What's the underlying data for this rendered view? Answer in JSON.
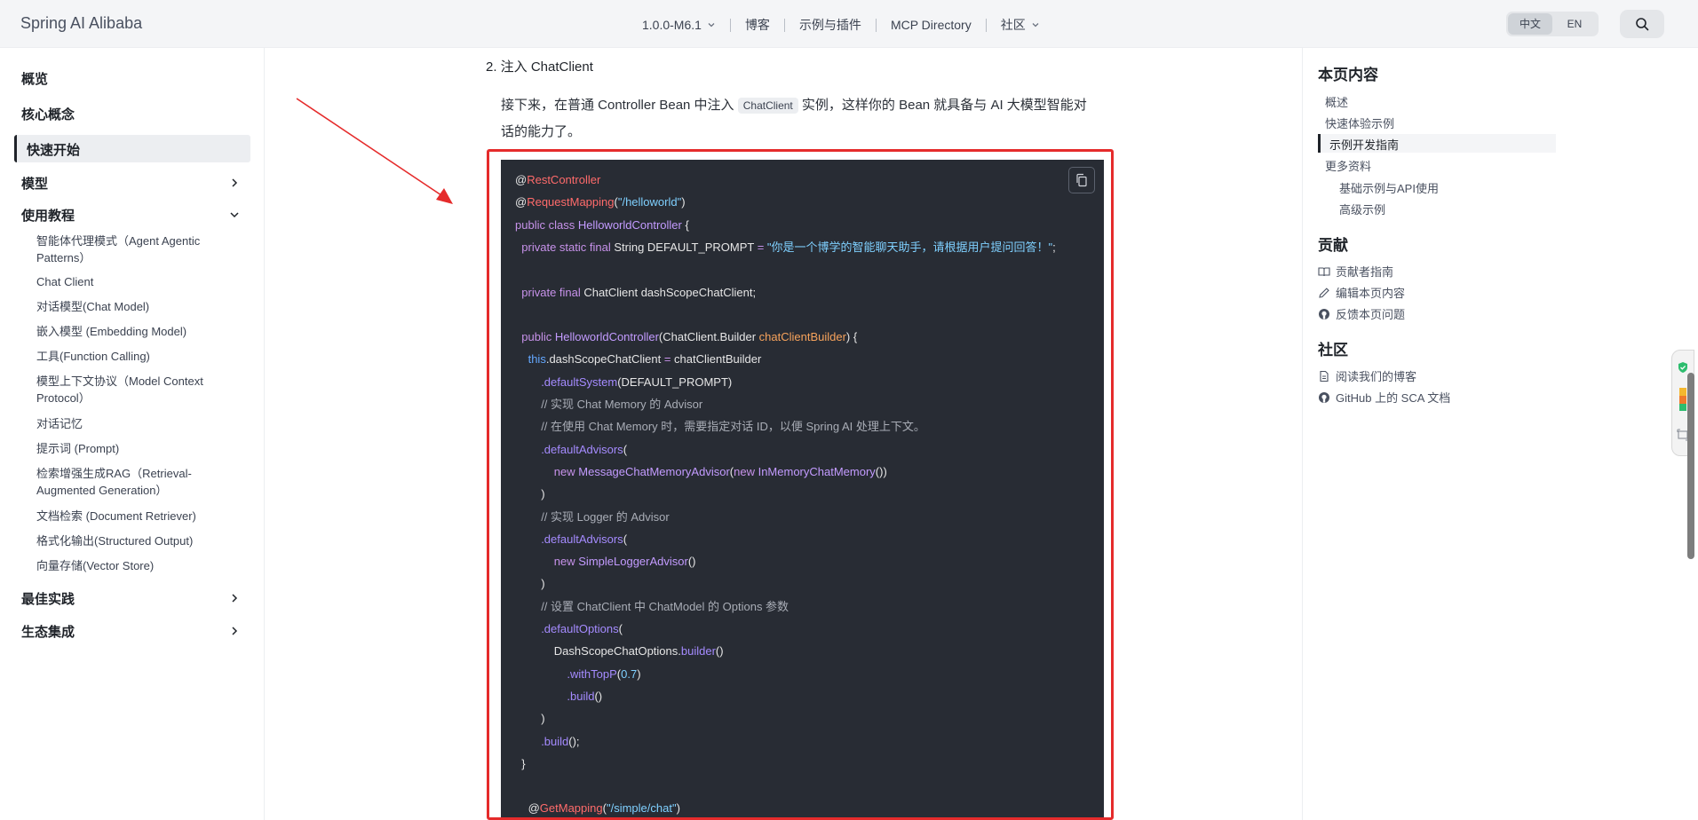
{
  "header": {
    "brand": "Spring AI Alibaba",
    "nav": [
      {
        "label": "1.0.0-M6.1",
        "dropdown": true
      },
      {
        "label": "博客",
        "dropdown": false
      },
      {
        "label": "示例与插件",
        "dropdown": false
      },
      {
        "label": "MCP Directory",
        "dropdown": false
      },
      {
        "label": "社区",
        "dropdown": true
      }
    ],
    "lang": {
      "zh": "中文",
      "en": "EN",
      "selected": "中文"
    },
    "search_icon": "search-icon"
  },
  "sidebar": {
    "overview": "概览",
    "core_concepts": "核心概念",
    "quick_start": "快速开始",
    "models": "模型",
    "tutorials": "使用教程",
    "tutorial_items": [
      "智能体代理模式（Agent Agentic Patterns）",
      "Chat Client",
      "对话模型(Chat Model)",
      "嵌入模型 (Embedding Model)",
      "工具(Function Calling)",
      "模型上下文协议（Model Context Protocol）",
      "对话记忆",
      "提示词 (Prompt)",
      "检索增强生成RAG（Retrieval-Augmented Generation）",
      "文档检索 (Document Retriever)",
      "格式化输出(Structured Output)",
      "向量存储(Vector Store)"
    ],
    "best_practices": "最佳实践",
    "ecosystem": "生态集成"
  },
  "content": {
    "step_title": "2. 注入 ChatClient",
    "intro_before": "接下来，在普通 Controller Bean 中注入 ",
    "intro_code": "ChatClient",
    "intro_after": " 实例，这样你的 Bean 就具备与 AI 大模型智能对话的能力了。",
    "code": [
      {
        "indent": 0,
        "tokens": [
          [
            "p",
            "@"
          ],
          [
            "ann",
            "RestController"
          ]
        ]
      },
      {
        "indent": 0,
        "tokens": [
          [
            "p",
            "@"
          ],
          [
            "ann",
            "RequestMapping"
          ],
          [
            "p",
            "("
          ],
          [
            "str",
            "\"/helloworld\""
          ],
          [
            "p",
            ")"
          ]
        ]
      },
      {
        "indent": 0,
        "tokens": [
          [
            "kw",
            "public class "
          ],
          [
            "cls",
            "HelloworldController"
          ],
          [
            "p",
            " {"
          ]
        ]
      },
      {
        "indent": 1,
        "tokens": [
          [
            "kw",
            "private static final "
          ],
          [
            "p",
            "String DEFAULT_PROMPT "
          ],
          [
            "kw",
            "= "
          ],
          [
            "str",
            "\"你是一个博学的智能聊天助手，请根据用户提问回答！\""
          ],
          [
            "p",
            ";"
          ]
        ]
      },
      {
        "indent": 0,
        "tokens": []
      },
      {
        "indent": 1,
        "tokens": [
          [
            "kw",
            "private final "
          ],
          [
            "p",
            "ChatClient dashScopeChatClient;"
          ]
        ]
      },
      {
        "indent": 0,
        "tokens": []
      },
      {
        "indent": 1,
        "tokens": [
          [
            "kw",
            "public "
          ],
          [
            "cls",
            "HelloworldController"
          ],
          [
            "p",
            "(ChatClient.Builder "
          ],
          [
            "par",
            "chatClientBuilder"
          ],
          [
            "p",
            ") {"
          ]
        ]
      },
      {
        "indent": 2,
        "tokens": [
          [
            "this",
            "this"
          ],
          [
            "p",
            ".dashScopeChatClient "
          ],
          [
            "kw",
            "= "
          ],
          [
            "p",
            "chatClientBuilder"
          ]
        ]
      },
      {
        "indent": 4,
        "tokens": [
          [
            "fn",
            ".defaultSystem"
          ],
          [
            "p",
            "(DEFAULT_PROMPT)"
          ]
        ]
      },
      {
        "indent": 4,
        "tokens": [
          [
            "cmt",
            "// 实现 Chat Memory 的 Advisor"
          ]
        ]
      },
      {
        "indent": 4,
        "tokens": [
          [
            "cmt",
            "// 在使用 Chat Memory 时，需要指定对话 ID，以便 Spring AI 处理上下文。"
          ]
        ]
      },
      {
        "indent": 4,
        "tokens": [
          [
            "fn",
            ".defaultAdvisors"
          ],
          [
            "p",
            "("
          ]
        ]
      },
      {
        "indent": 6,
        "tokens": [
          [
            "kw",
            "new "
          ],
          [
            "cls",
            "MessageChatMemoryAdvisor"
          ],
          [
            "p",
            "("
          ],
          [
            "kw",
            "new "
          ],
          [
            "cls",
            "InMemoryChatMemory"
          ],
          [
            "p",
            "())"
          ]
        ]
      },
      {
        "indent": 4,
        "tokens": [
          [
            "p",
            ")"
          ]
        ]
      },
      {
        "indent": 4,
        "tokens": [
          [
            "cmt",
            "// 实现 Logger 的 Advisor"
          ]
        ]
      },
      {
        "indent": 4,
        "tokens": [
          [
            "fn",
            ".defaultAdvisors"
          ],
          [
            "p",
            "("
          ]
        ]
      },
      {
        "indent": 6,
        "tokens": [
          [
            "kw",
            "new "
          ],
          [
            "cls",
            "SimpleLoggerAdvisor"
          ],
          [
            "p",
            "()"
          ]
        ]
      },
      {
        "indent": 4,
        "tokens": [
          [
            "p",
            ")"
          ]
        ]
      },
      {
        "indent": 4,
        "tokens": [
          [
            "cmt",
            "// 设置 ChatClient 中 ChatModel 的 Options 参数"
          ]
        ]
      },
      {
        "indent": 4,
        "tokens": [
          [
            "fn",
            ".defaultOptions"
          ],
          [
            "p",
            "("
          ]
        ]
      },
      {
        "indent": 6,
        "tokens": [
          [
            "p",
            "DashScopeChatOptions."
          ],
          [
            "fn",
            "builder"
          ],
          [
            "p",
            "()"
          ]
        ]
      },
      {
        "indent": 8,
        "tokens": [
          [
            "fn",
            ".withTopP"
          ],
          [
            "p",
            "("
          ],
          [
            "num",
            "0.7"
          ],
          [
            "p",
            ")"
          ]
        ]
      },
      {
        "indent": 8,
        "tokens": [
          [
            "fn",
            ".build"
          ],
          [
            "p",
            "()"
          ]
        ]
      },
      {
        "indent": 4,
        "tokens": [
          [
            "p",
            ")"
          ]
        ]
      },
      {
        "indent": 4,
        "tokens": [
          [
            "fn",
            ".build"
          ],
          [
            "p",
            "();"
          ]
        ]
      },
      {
        "indent": 1,
        "tokens": [
          [
            "p",
            "}"
          ]
        ]
      },
      {
        "indent": 0,
        "tokens": []
      },
      {
        "indent": 2,
        "tokens": [
          [
            "p",
            "@"
          ],
          [
            "ann",
            "GetMapping"
          ],
          [
            "p",
            "("
          ],
          [
            "str",
            "\"/simple/chat\""
          ],
          [
            "p",
            ")"
          ]
        ]
      }
    ]
  },
  "toc": {
    "title": "本页内容",
    "items": [
      {
        "label": "概述",
        "level": 1,
        "active": false
      },
      {
        "label": "快速体验示例",
        "level": 1,
        "active": false
      },
      {
        "label": "示例开发指南",
        "level": 1,
        "active": true
      },
      {
        "label": "更多资料",
        "level": 1,
        "active": false
      },
      {
        "label": "基础示例与API使用",
        "level": 2,
        "active": false
      },
      {
        "label": "高级示例",
        "level": 2,
        "active": false
      }
    ],
    "contribute_title": "贡献",
    "contribute_links": [
      {
        "label": "贡献者指南",
        "icon": "book-icon"
      },
      {
        "label": "编辑本页内容",
        "icon": "pencil-icon"
      },
      {
        "label": "反馈本页问题",
        "icon": "github-icon"
      }
    ],
    "community_title": "社区",
    "community_links": [
      {
        "label": "阅读我们的博客",
        "icon": "document-icon"
      },
      {
        "label": "GitHub 上的 SCA 文档",
        "icon": "github-icon"
      }
    ]
  },
  "colors": {
    "highlight_border": "#e52b2b",
    "code_background": "#282c34",
    "annotation": "#ff6b6b",
    "keyword": "#c792ea",
    "string": "#7fd0ff",
    "comment": "#a9adb6"
  }
}
